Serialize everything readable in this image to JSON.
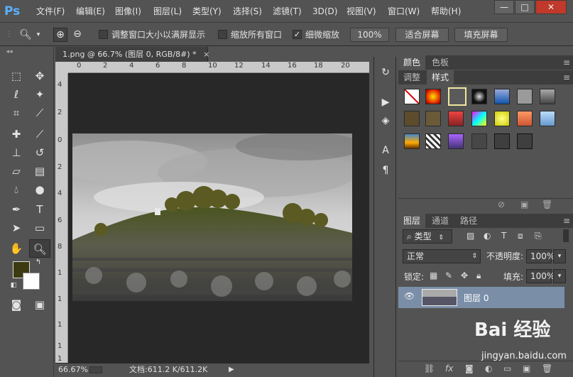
{
  "app": {
    "logo": "Ps"
  },
  "menu": [
    "文件(F)",
    "编辑(E)",
    "图像(I)",
    "图层(L)",
    "类型(Y)",
    "选择(S)",
    "滤镜(T)",
    "3D(D)",
    "视图(V)",
    "窗口(W)",
    "帮助(H)"
  ],
  "window_controls": {
    "minimize": "—",
    "maximize": "□",
    "close": "✕"
  },
  "options": {
    "resize_windows": "调整窗口大小以满屏显示",
    "zoom_all": "缩放所有窗口",
    "scrubby_zoom": "细微缩放",
    "zoom_100": "100%",
    "fit_screen": "适合屏幕",
    "fill_screen": "填充屏幕"
  },
  "document": {
    "tab_title": "1.png @ 66.7% (图层 0, RGB/8#) *",
    "zoom": "66.67%",
    "status": "文档:611.2 K/611.2K",
    "ruler_top": [
      "0",
      "2",
      "4",
      "6",
      "8",
      "10",
      "12",
      "14",
      "16",
      "18",
      "20"
    ],
    "ruler_left": [
      "4",
      "2",
      "0",
      "2",
      "4",
      "6",
      "8",
      "1",
      "1",
      "1",
      "1",
      "1"
    ]
  },
  "panels": {
    "color_tabs": [
      "颜色",
      "色板"
    ],
    "style_tabs": [
      "调整",
      "样式"
    ],
    "layer_tabs": [
      "图层",
      "通道",
      "路径"
    ],
    "filter_kind": "类型",
    "blend_mode": "正常",
    "opacity_label": "不透明度:",
    "opacity": "100%",
    "lock_label": "锁定:",
    "fill_label": "填充:",
    "fill": "100%",
    "layer_name": "图层 0"
  },
  "watermark": {
    "brand": "Bai 经验",
    "url": "jingyan.baidu.com"
  },
  "colors": {
    "foreground": "#3c3a10",
    "background": "#ffffff",
    "accent": "#5ab1ff",
    "layer_selected": "#7a8ea8"
  }
}
